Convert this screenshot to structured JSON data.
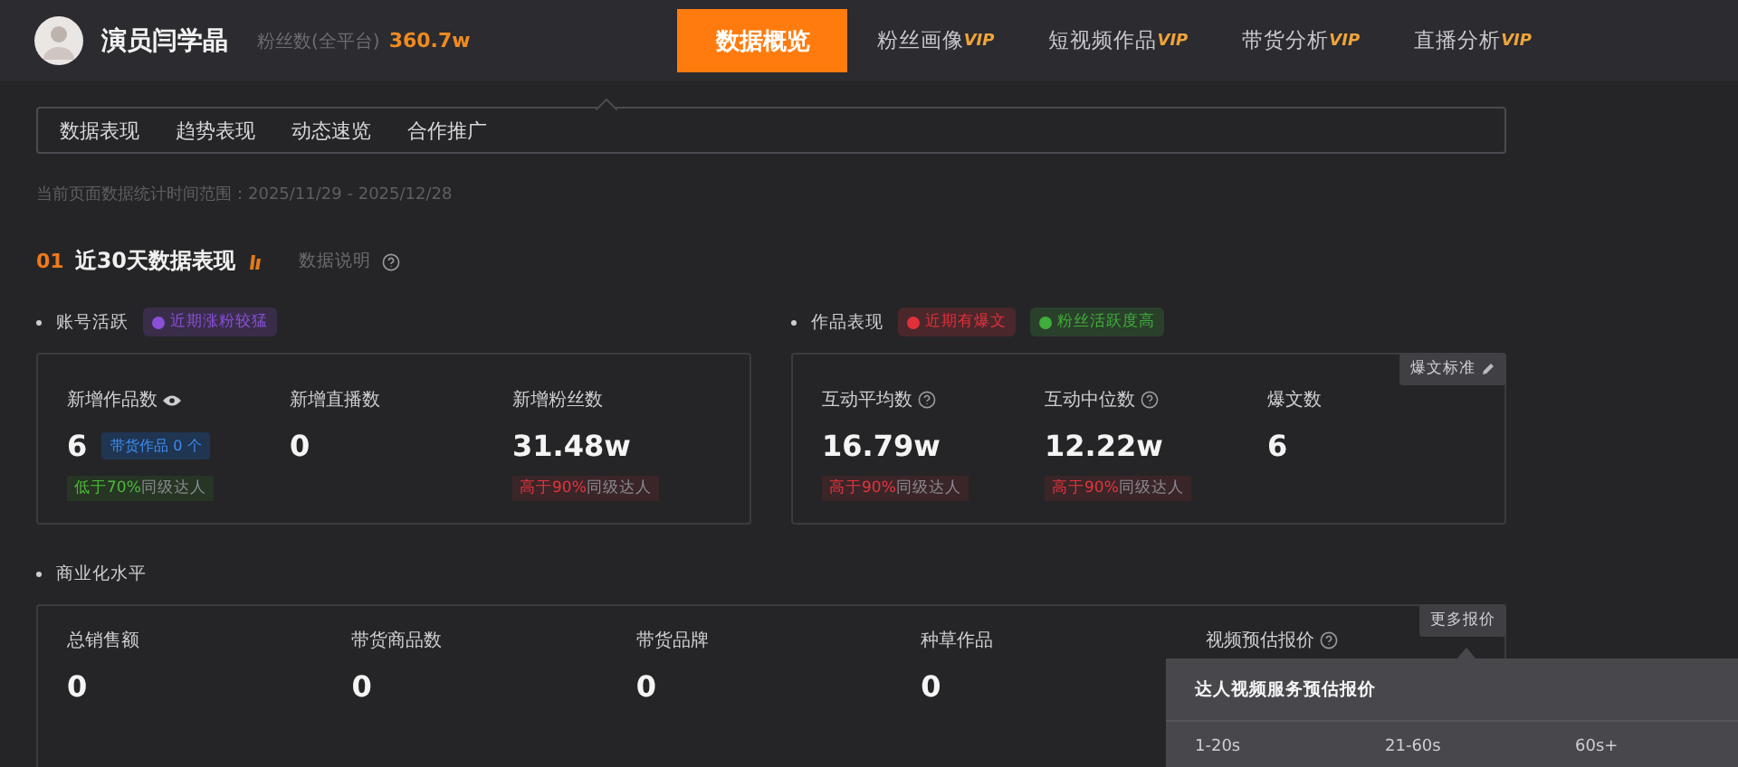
{
  "header": {
    "name": "演员闫学晶",
    "fans_label": "粉丝数(全平台)",
    "fans_value": "360.7w",
    "nav": [
      {
        "label": "数据概览",
        "selected": true
      },
      {
        "label": "粉丝画像",
        "vip": "VIP",
        "selected": false
      },
      {
        "label": "短视频作品",
        "vip": "VIP",
        "selected": false
      },
      {
        "label": "带货分析",
        "vip": "VIP",
        "selected": false
      },
      {
        "label": "直播分析",
        "vip": "VIP",
        "selected": false
      }
    ]
  },
  "subnav": [
    {
      "label": "数据表现"
    },
    {
      "label": "趋势表现"
    },
    {
      "label": "动态速览"
    },
    {
      "label": "合作推广"
    }
  ],
  "date_range": "当前页面数据统计时间范围：2025/11/29 - 2025/12/28",
  "section": {
    "number": "01",
    "title": "近30天数据表现",
    "help": "数据说明"
  },
  "groups": [
    {
      "label": "账号活跃",
      "tags": [
        {
          "text": "近期涨粉较猛",
          "color": "#8a4fd6"
        }
      ],
      "metrics": [
        {
          "label": "新增作品数",
          "kind": "views",
          "value": "6",
          "badge": "带货作品 0 个",
          "compare": {
            "kind": "below",
            "highlight": "低于70%",
            "rest": "同级达人"
          }
        },
        {
          "label": "新增直播数",
          "value": "0"
        },
        {
          "label": "新增粉丝数",
          "value": "31.48w",
          "compare": {
            "kind": "above",
            "highlight": "高于90%",
            "rest": "同级达人"
          }
        }
      ]
    },
    {
      "label": "作品表现",
      "tags": [
        {
          "text": "近期有爆文",
          "color": "#e0303a"
        },
        {
          "text": "粉丝活跃度高",
          "color": "#3fae3a"
        }
      ],
      "corner": "爆文标准",
      "metrics": [
        {
          "label": "互动平均数",
          "kind": "help",
          "value": "16.79w",
          "compare": {
            "kind": "above",
            "highlight": "高于90%",
            "rest": "同级达人"
          }
        },
        {
          "label": "互动中位数",
          "kind": "help",
          "value": "12.22w",
          "compare": {
            "kind": "above",
            "highlight": "高于90%",
            "rest": "同级达人"
          }
        },
        {
          "label": "爆文数",
          "value": "6"
        }
      ]
    }
  ],
  "commerce": {
    "label": "商业化水平",
    "corner": "更多报价",
    "metrics": [
      {
        "label": "总销售额",
        "value": "0"
      },
      {
        "label": "带货商品数",
        "value": "0"
      },
      {
        "label": "带货品牌",
        "value": "0"
      },
      {
        "label": "种草作品",
        "value": "0"
      },
      {
        "label": "视频预估报价",
        "kind": "help"
      }
    ]
  },
  "popup": {
    "title": "达人视频服务预估报价",
    "columns": [
      "1-20s",
      "21-60s",
      "60s+"
    ]
  }
}
